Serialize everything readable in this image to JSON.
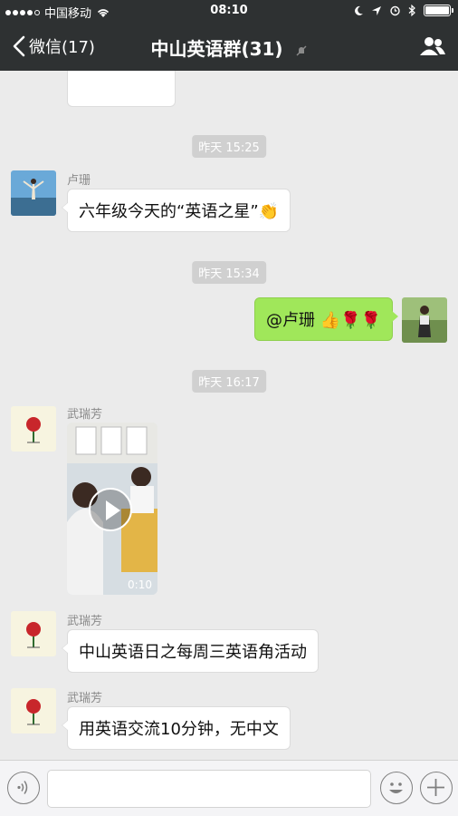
{
  "status_bar": {
    "carrier": "中国移动",
    "time": "08:10",
    "battery_level": 1.0
  },
  "nav": {
    "back_label": "微信(17)",
    "title": "中山英语群(31)"
  },
  "messages": [
    {
      "type": "timestamp",
      "text": "昨天 15:25"
    },
    {
      "type": "incoming",
      "sender": "卢珊",
      "text": "六年级今天的“英语之星”👏"
    },
    {
      "type": "timestamp",
      "text": "昨天 15:34"
    },
    {
      "type": "outgoing",
      "text": "@卢珊 👍🌹🌹"
    },
    {
      "type": "timestamp",
      "text": "昨天 16:17"
    },
    {
      "type": "video",
      "sender": "武瑞芳",
      "duration": "0:10"
    },
    {
      "type": "incoming",
      "sender": "武瑞芳",
      "text": "中山英语日之每周三英语角活动"
    },
    {
      "type": "incoming",
      "sender": "武瑞芳",
      "text": "用英语交流10分钟，无中文"
    }
  ],
  "icons": {
    "back": "chevron-left-icon",
    "mute": "bell-off-icon",
    "group_info": "people-icon",
    "voice": "voice-icon",
    "emoji": "emoji-icon",
    "more": "plus-icon"
  },
  "colors": {
    "bar": "#2e3132",
    "outgoing_bubble": "#a0e75a",
    "chat_background": "#ebebeb"
  }
}
